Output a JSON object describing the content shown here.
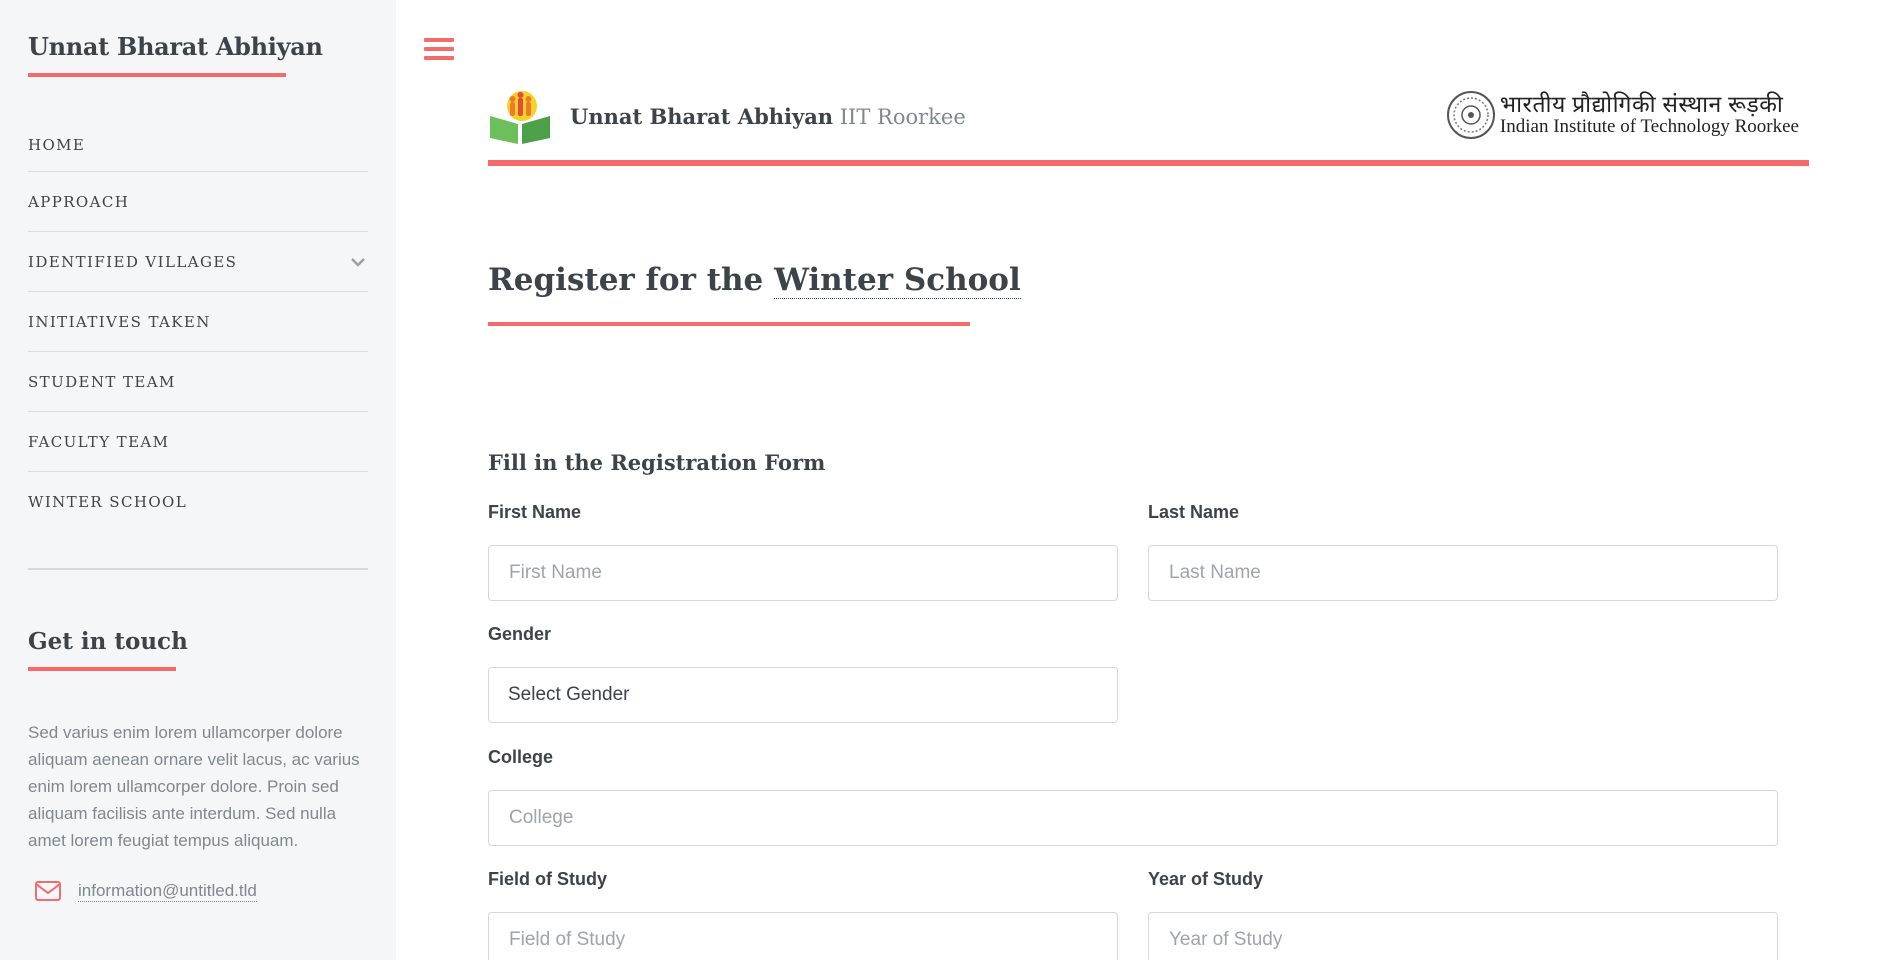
{
  "sidebar": {
    "brand": "Unnat Bharat Abhiyan",
    "nav": [
      {
        "label": "HOME"
      },
      {
        "label": "APPROACH"
      },
      {
        "label": "IDENTIFIED VILLAGES"
      },
      {
        "label": "INITIATIVES TAKEN"
      },
      {
        "label": "STUDENT TEAM"
      },
      {
        "label": "FACULTY TEAM"
      },
      {
        "label": "WINTER SCHOOL"
      }
    ],
    "get_in_touch": {
      "title": "Get in touch",
      "text": "Sed varius enim lorem ullamcorper dolore aliquam aenean ornare velit lacus, ac varius enim lorem ullamcorper dolore. Proin sed aliquam facilisis ante interdum. Sed nulla amet lorem feugiat tempus aliquam.",
      "email": "information@untitled.tld"
    }
  },
  "header": {
    "title_strong": "Unnat Bharat Abhiyan",
    "title_light": "IIT Roorkee",
    "institute_hindi": "भारतीय प्रौद्योगिकी संस्थान रूड़की",
    "institute_english": "Indian Institute of Technology Roorkee"
  },
  "page": {
    "title_prefix": "Register for the",
    "title_highlight": "Winter School",
    "form_title": "Fill in the Registration Form"
  },
  "form": {
    "first_name": {
      "label": "First Name",
      "placeholder": "First Name"
    },
    "last_name": {
      "label": "Last Name",
      "placeholder": "Last Name"
    },
    "gender": {
      "label": "Gender",
      "value": "Select Gender"
    },
    "college": {
      "label": "College",
      "placeholder": "College"
    },
    "field_of_study": {
      "label": "Field of Study",
      "placeholder": "Field of Study"
    },
    "year_of_study": {
      "label": "Year of Study",
      "placeholder": "Year of Study"
    }
  },
  "colors": {
    "accent": "#f56a6a",
    "sidebar_bg": "#f5f6f7",
    "text": "#3d4449",
    "muted": "#7f888f"
  }
}
